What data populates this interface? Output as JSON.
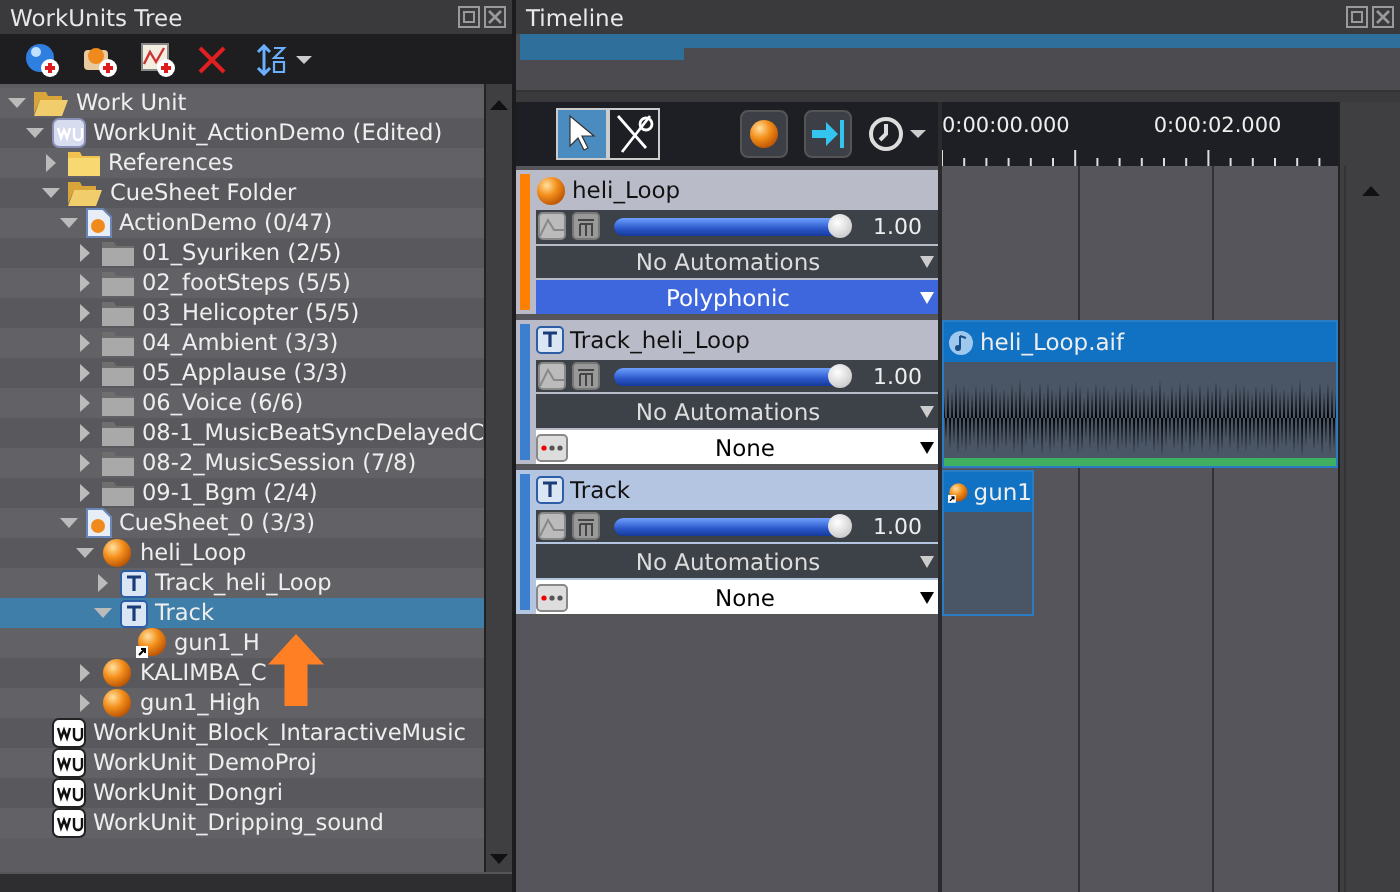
{
  "tree_panel": {
    "title": "WorkUnits Tree",
    "items": [
      {
        "label": "Work Unit",
        "kind": "folder-open",
        "expanded": true,
        "selected": false,
        "children": [
          {
            "label": "WorkUnit_ActionDemo (Edited)",
            "kind": "workunit",
            "expanded": true,
            "selected": false,
            "children": [
              {
                "label": "References",
                "kind": "folder",
                "expanded": false,
                "selected": false
              },
              {
                "label": "CueSheet Folder",
                "kind": "folder-open",
                "expanded": true,
                "selected": false,
                "children": [
                  {
                    "label": "ActionDemo (0/47)",
                    "kind": "cuesheet",
                    "expanded": true,
                    "selected": false,
                    "children": [
                      {
                        "label": "01_Syuriken (2/5)",
                        "kind": "category",
                        "expanded": false,
                        "selected": false
                      },
                      {
                        "label": "02_footSteps (5/5)",
                        "kind": "category",
                        "expanded": false,
                        "selected": false
                      },
                      {
                        "label": "03_Helicopter (5/5)",
                        "kind": "category",
                        "expanded": false,
                        "selected": false
                      },
                      {
                        "label": "04_Ambient (3/3)",
                        "kind": "category",
                        "expanded": false,
                        "selected": false
                      },
                      {
                        "label": "05_Applause (3/3)",
                        "kind": "category",
                        "expanded": false,
                        "selected": false
                      },
                      {
                        "label": "06_Voice (6/6)",
                        "kind": "category",
                        "expanded": false,
                        "selected": false
                      },
                      {
                        "label": "08-1_MusicBeatSyncDelayedC",
                        "kind": "category",
                        "expanded": false,
                        "selected": false
                      },
                      {
                        "label": "08-2_MusicSession (7/8)",
                        "kind": "category",
                        "expanded": false,
                        "selected": false
                      },
                      {
                        "label": "09-1_Bgm (2/4)",
                        "kind": "category",
                        "expanded": false,
                        "selected": false
                      }
                    ]
                  },
                  {
                    "label": "CueSheet_0 (3/3)",
                    "kind": "cuesheet",
                    "expanded": true,
                    "selected": false,
                    "children": [
                      {
                        "label": "heli_Loop",
                        "kind": "cue",
                        "expanded": true,
                        "selected": false,
                        "children": [
                          {
                            "label": "Track_heli_Loop",
                            "kind": "track",
                            "expanded": false,
                            "selected": false
                          },
                          {
                            "label": "Track",
                            "kind": "track",
                            "expanded": true,
                            "selected": true,
                            "children": [
                              {
                                "label": "gun1_H",
                                "kind": "cue-ref",
                                "selected": false
                              }
                            ]
                          }
                        ]
                      },
                      {
                        "label": "KALIMBA_C",
                        "kind": "cue",
                        "expanded": false,
                        "selected": false
                      },
                      {
                        "label": "gun1_High",
                        "kind": "cue",
                        "expanded": false,
                        "selected": false
                      }
                    ]
                  }
                ]
              }
            ]
          },
          {
            "label": "WorkUnit_Block_IntaractiveMusic",
            "kind": "workunit-plain",
            "selected": false
          },
          {
            "label": "WorkUnit_DemoProj",
            "kind": "workunit-plain",
            "selected": false
          },
          {
            "label": "WorkUnit_Dongri",
            "kind": "workunit-plain",
            "selected": false
          },
          {
            "label": "WorkUnit_Dripping_sound",
            "kind": "workunit-plain",
            "selected": false
          }
        ]
      }
    ]
  },
  "timeline": {
    "title": "Timeline",
    "tools": [
      {
        "kind": "pointer",
        "selected": true
      },
      {
        "kind": "scissors",
        "selected": false
      }
    ],
    "ruler": [
      "0:00:00.000",
      "0:00:02.000"
    ],
    "tracks": [
      {
        "name": "heli_Loop",
        "kind": "cue",
        "color": "#ff8000",
        "selected": false,
        "level": 1,
        "reading": "1.00",
        "automation": "No Automations",
        "mode": {
          "kind": "polyphonic",
          "label": "Polyphonic"
        }
      },
      {
        "name": "Track_heli_Loop",
        "kind": "track",
        "color": "#3d7fcf",
        "selected": false,
        "level": 1,
        "reading": "1.00",
        "automation": "No Automations",
        "mode": {
          "kind": "none",
          "label": "None"
        },
        "clip": {
          "kind": "waveform",
          "label": "heli_Loop.aif"
        }
      },
      {
        "name": "Track",
        "kind": "track",
        "color": "#3d7fcf",
        "selected": true,
        "level": 1,
        "reading": "1.00",
        "automation": "No Automations",
        "mode": {
          "kind": "none",
          "label": "None"
        },
        "clip": {
          "kind": "cue",
          "label": "gun1"
        }
      }
    ]
  }
}
